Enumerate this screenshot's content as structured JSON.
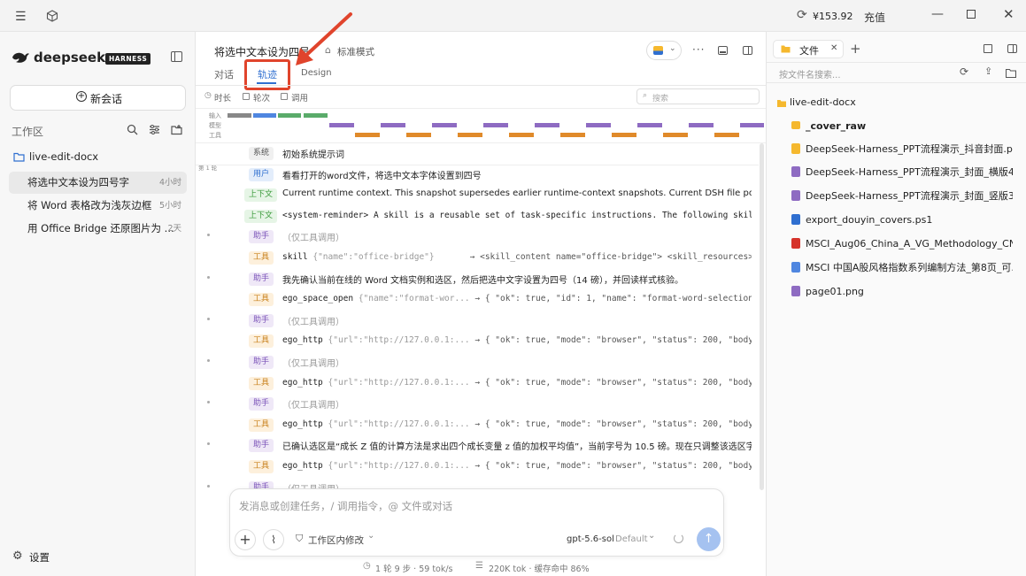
{
  "titlebar": {
    "balance": "¥153.92",
    "recharge": "充值"
  },
  "sidebar": {
    "brand": "deepseek",
    "brand_badge": "HARNESS",
    "new_chat": "新会话",
    "workspace_label": "工作区",
    "folder": "live-edit-docx",
    "conversations": [
      {
        "title": "将选中文本设为四号字",
        "time": "4小时"
      },
      {
        "title": "将 Word 表格改为浅灰边框",
        "time": "5小时"
      },
      {
        "title": "用 Office Bridge 还原图片为 ...",
        "time": "2天"
      }
    ],
    "settings": "设置"
  },
  "main": {
    "title": "将选中文本设为四号",
    "mode": "标准模式",
    "tabs": [
      "对话",
      "轨迹",
      "Design"
    ],
    "filters": [
      "时长",
      "轮次",
      "调用"
    ],
    "search_placeholder": "搜索",
    "timeline_labels": [
      "输入",
      "模型",
      "工具"
    ],
    "round_label": "第 1 轮",
    "rows": [
      {
        "tag": "系统",
        "kind": "sys",
        "text": "初始系统提示词"
      },
      {
        "tag": "用户",
        "kind": "user",
        "text": "看看打开的word文件，将选中文本字体设置到四号"
      },
      {
        "tag": "上下文",
        "kind": "ctx",
        "text": "Current runtime context. This snapshot supersedes earlier runtime-context snapshots. Current DSH file policy: workspace-writ..."
      },
      {
        "tag": "上下文",
        "kind": "ctx",
        "text": "<system-reminder> A skill is a reusable set of task-specific instructions. The following skills are available in this session: <avail..."
      },
      {
        "tag": "助手",
        "kind": "ast",
        "text": "（仅工具调用）"
      },
      {
        "tag": "工具",
        "kind": "tool",
        "name": "skill",
        "args": "{\"name\":\"office-bridge\"}",
        "result": "→ <skill_content name=\"office-bridge\"> <skill_resources> Base d..."
      },
      {
        "tag": "助手",
        "kind": "ast",
        "text": "我先确认当前在线的 Word 文档实例和选区，然后把选中文字设置为四号（14 磅），并回读样式核验。"
      },
      {
        "tag": "工具",
        "kind": "tool",
        "name": "ego_space_open",
        "args": "{\"name\":\"format-wor...",
        "result": "→ { \"ok\": true, \"id\": 1, \"name\": \"format-word-selection\" }"
      },
      {
        "tag": "助手",
        "kind": "ast",
        "text": "（仅工具调用）"
      },
      {
        "tag": "工具",
        "kind": "tool",
        "name": "ego_http",
        "args": "{\"url\":\"http://127.0.0.1:...",
        "result": "→ { \"ok\": true, \"mode\": \"browser\", \"status\": 200, \"body\": \"{\"pe..."
      },
      {
        "tag": "助手",
        "kind": "ast",
        "text": "（仅工具调用）"
      },
      {
        "tag": "工具",
        "kind": "tool",
        "name": "ego_http",
        "args": "{\"url\":\"http://127.0.0.1:...",
        "result": "→ { \"ok\": true, \"mode\": \"browser\", \"status\": 200, \"body\": \"{\"ok..."
      },
      {
        "tag": "助手",
        "kind": "ast",
        "text": "（仅工具调用）"
      },
      {
        "tag": "工具",
        "kind": "tool",
        "name": "ego_http",
        "args": "{\"url\":\"http://127.0.0.1:...",
        "result": "→ { \"ok\": true, \"mode\": \"browser\", \"status\": 200, \"body\": \"{\"ve..."
      },
      {
        "tag": "助手",
        "kind": "ast",
        "text": "已确认选区是“成长 Z 值的计算方法是求出四个成长变量 z 值的加权平均值”，当前字号为 10.5 磅。现在只调整该选区字号为 1..."
      },
      {
        "tag": "工具",
        "kind": "tool",
        "name": "ego_http",
        "args": "{\"url\":\"http://127.0.0.1:...",
        "result": "→ { \"ok\": true, \"mode\": \"browser\", \"status\": 200, \"body\": \"{\"ok..."
      },
      {
        "tag": "助手",
        "kind": "ast",
        "text": "（仅工具调用）"
      }
    ],
    "composer": {
      "placeholder": "发消息或创建任务，/ 调用指令，@ 文件或对话",
      "scope": "工作区内修改",
      "model": "gpt-5.6-sol",
      "model_variant": "Default"
    },
    "status": {
      "rounds": "1 轮 9 步 · 59 tok/s",
      "tokens": "220K tok · 缓存命中 86%"
    }
  },
  "files": {
    "tab": "文件",
    "search_placeholder": "按文件名搜索...",
    "root": "live-edit-docx",
    "items": [
      {
        "name": "_cover_raw",
        "type": "folder"
      },
      {
        "name": "DeepSeek-Harness_PPT流程演示_抖音封面.pptx",
        "type": "pptx"
      },
      {
        "name": "DeepSeek-Harness_PPT流程演示_封面_横版4...",
        "type": "image"
      },
      {
        "name": "DeepSeek-Harness_PPT流程演示_封面_竖版3...",
        "type": "image"
      },
      {
        "name": "export_douyin_covers.ps1",
        "type": "script"
      },
      {
        "name": "MSCI_Aug06_China_A_VG_Methodology_CN.pdf",
        "type": "pdf"
      },
      {
        "name": "MSCI 中国A股风格指数系列编制方法_第8页_可...",
        "type": "doc"
      },
      {
        "name": "page01.png",
        "type": "image"
      }
    ]
  },
  "colors": {
    "accent": "#2f6fd0",
    "annotation": "#e0442c",
    "tool": "#e08a2a",
    "model": "#8e6bc2",
    "input_blue": "#4f86e0",
    "input_green": "#5aab6a"
  }
}
